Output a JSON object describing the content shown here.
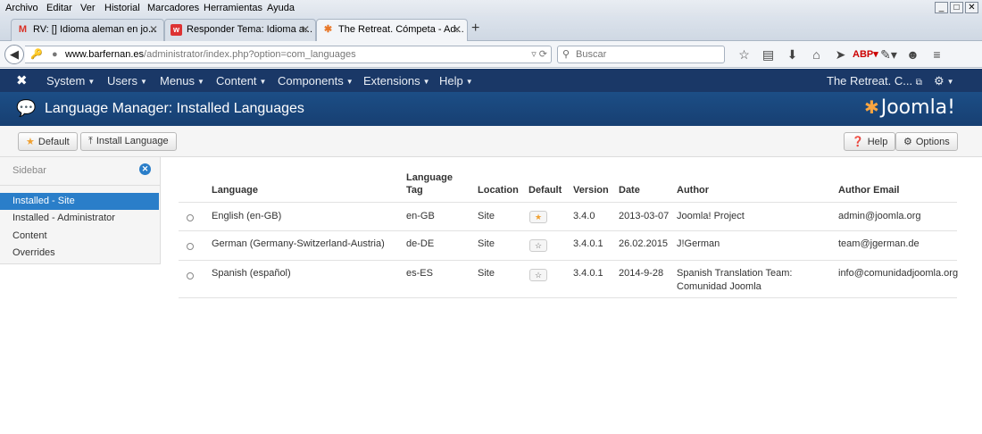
{
  "browser": {
    "menu": [
      "Archivo",
      "Editar",
      "Ver",
      "Historial",
      "Marcadores",
      "Herramientas",
      "Ayuda"
    ],
    "window_controls": [
      "_",
      "□",
      "✕"
    ],
    "tabs": [
      {
        "label": "RV: [] Idioma aleman en jo...",
        "icon": "gmail-icon"
      },
      {
        "label": "Responder Tema: Idioma a...",
        "icon": "site-icon"
      },
      {
        "label": "The Retreat. Cómpeta - Ad...",
        "icon": "joomla-icon"
      }
    ],
    "url_host": "www.barfernan.es",
    "url_path": "/administrator/index.php?option=com_languages",
    "search_placeholder": "Buscar"
  },
  "joomla": {
    "nav": [
      {
        "label": "System"
      },
      {
        "label": "Users"
      },
      {
        "label": "Menus"
      },
      {
        "label": "Content"
      },
      {
        "label": "Components"
      },
      {
        "label": "Extensions"
      },
      {
        "label": "Help"
      }
    ],
    "site_link": "The Retreat. C...",
    "page_title": "Language Manager: Installed Languages",
    "brand": "Joomla!",
    "toolbar": {
      "default_label": "Default",
      "install_label": "Install Language",
      "help_label": "Help",
      "options_label": "Options"
    },
    "sidebar": {
      "title": "Sidebar",
      "items": [
        "Installed - Site",
        "Installed - Administrator",
        "Content",
        "Overrides"
      ]
    },
    "table": {
      "headers": {
        "language": "Language",
        "tag_line1": "Language",
        "tag_line2": "Tag",
        "location": "Location",
        "default": "Default",
        "version": "Version",
        "date": "Date",
        "author": "Author",
        "email": "Author Email"
      },
      "rows": [
        {
          "language": "English (en-GB)",
          "tag": "en-GB",
          "location": "Site",
          "default": true,
          "version": "3.4.0",
          "date": "2013-03-07",
          "author_line1": "Joomla! Project",
          "author_line2": "",
          "email": "admin@joomla.org"
        },
        {
          "language": "German (Germany-Switzerland-Austria)",
          "tag": "de-DE",
          "location": "Site",
          "default": false,
          "version": "3.4.0.1",
          "date": "26.02.2015",
          "author_line1": "J!German",
          "author_line2": "",
          "email": "team@jgerman.de"
        },
        {
          "language": "Spanish (español)",
          "tag": "es-ES",
          "location": "Site",
          "default": false,
          "version": "3.4.0.1",
          "date": "2014-9-28",
          "author_line1": "Spanish Translation Team:",
          "author_line2": "Comunidad Joomla",
          "email": "info@comunidadjoomla.org"
        }
      ]
    }
  }
}
